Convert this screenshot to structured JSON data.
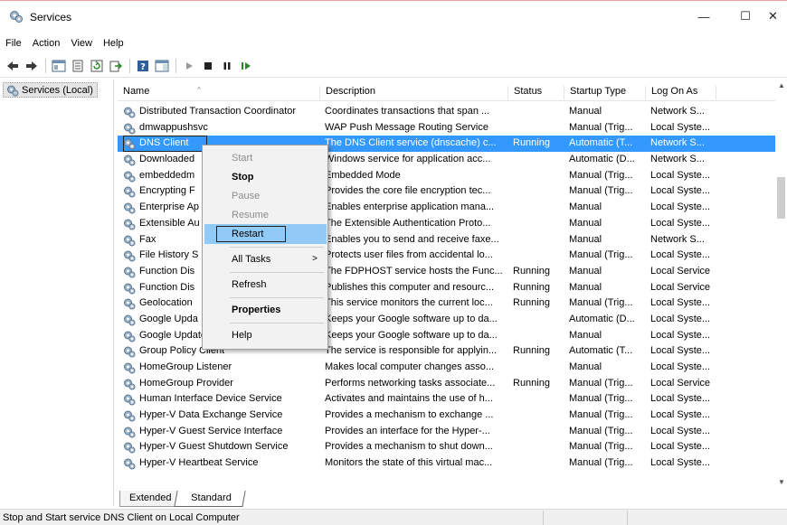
{
  "window": {
    "title": "Services",
    "min_glyph": "—",
    "max_glyph": "☐",
    "close_glyph": "✕"
  },
  "menubar": {
    "items": [
      "File",
      "Action",
      "View",
      "Help"
    ]
  },
  "tree": {
    "root_label": "Services (Local)"
  },
  "list": {
    "columns": [
      "Name",
      "Description",
      "Status",
      "Startup Type",
      "Log On As"
    ],
    "rows": [
      {
        "name": "Distributed Transaction Coordinator",
        "description": "Coordinates transactions that span ...",
        "status": "",
        "startup": "Manual",
        "logon": "Network S..."
      },
      {
        "name": "dmwappushsvc",
        "description": "WAP Push Message Routing Service",
        "status": "",
        "startup": "Manual (Trig...",
        "logon": "Local Syste..."
      },
      {
        "name": "DNS Client",
        "description": "The DNS Client service (dnscache) c...",
        "status": "Running",
        "startup": "Automatic (T...",
        "logon": "Network S..."
      },
      {
        "name": "Downloaded",
        "description": "Windows service for application acc...",
        "status": "",
        "startup": "Automatic (D...",
        "logon": "Network S..."
      },
      {
        "name": "embeddedm",
        "description": "Embedded Mode",
        "status": "",
        "startup": "Manual (Trig...",
        "logon": "Local Syste..."
      },
      {
        "name": "Encrypting F",
        "description": "Provides the core file encryption tec...",
        "status": "",
        "startup": "Manual (Trig...",
        "logon": "Local Syste..."
      },
      {
        "name": "Enterprise Ap",
        "description": "Enables enterprise application mana...",
        "status": "",
        "startup": "Manual",
        "logon": "Local Syste..."
      },
      {
        "name": "Extensible Au",
        "description": "The Extensible Authentication Proto...",
        "status": "",
        "startup": "Manual",
        "logon": "Local Syste..."
      },
      {
        "name": "Fax",
        "description": "Enables you to send and receive faxe...",
        "status": "",
        "startup": "Manual",
        "logon": "Network S..."
      },
      {
        "name": "File History S",
        "description": "Protects user files from accidental lo...",
        "status": "",
        "startup": "Manual (Trig...",
        "logon": "Local Syste..."
      },
      {
        "name": "Function Dis",
        "description": "The FDPHOST service hosts the Func...",
        "status": "Running",
        "startup": "Manual",
        "logon": "Local Service"
      },
      {
        "name": "Function Dis",
        "description": "Publishes this computer and resourc...",
        "status": "Running",
        "startup": "Manual",
        "logon": "Local Service"
      },
      {
        "name": "Geolocation",
        "description": "This service monitors the current loc...",
        "status": "Running",
        "startup": "Manual (Trig...",
        "logon": "Local Syste..."
      },
      {
        "name": "Google Upda",
        "description": "Keeps your Google software up to da...",
        "status": "",
        "startup": "Automatic (D...",
        "logon": "Local Syste..."
      },
      {
        "name": "Google Update Service (gupdatem)",
        "description": "Keeps your Google software up to da...",
        "status": "",
        "startup": "Manual",
        "logon": "Local Syste..."
      },
      {
        "name": "Group Policy Client",
        "description": "The service is responsible for applyin...",
        "status": "Running",
        "startup": "Automatic (T...",
        "logon": "Local Syste..."
      },
      {
        "name": "HomeGroup Listener",
        "description": "Makes local computer changes asso...",
        "status": "",
        "startup": "Manual",
        "logon": "Local Syste..."
      },
      {
        "name": "HomeGroup Provider",
        "description": "Performs networking tasks associate...",
        "status": "Running",
        "startup": "Manual (Trig...",
        "logon": "Local Service"
      },
      {
        "name": "Human Interface Device Service",
        "description": "Activates and maintains the use of h...",
        "status": "",
        "startup": "Manual (Trig...",
        "logon": "Local Syste..."
      },
      {
        "name": "Hyper-V Data Exchange Service",
        "description": "Provides a mechanism to exchange ...",
        "status": "",
        "startup": "Manual (Trig...",
        "logon": "Local Syste..."
      },
      {
        "name": "Hyper-V Guest Service Interface",
        "description": "Provides an interface for the Hyper-...",
        "status": "",
        "startup": "Manual (Trig...",
        "logon": "Local Syste..."
      },
      {
        "name": "Hyper-V Guest Shutdown Service",
        "description": "Provides a mechanism to shut down...",
        "status": "",
        "startup": "Manual (Trig...",
        "logon": "Local Syste..."
      },
      {
        "name": "Hyper-V Heartbeat Service",
        "description": "Monitors the state of this virtual mac...",
        "status": "",
        "startup": "Manual (Trig...",
        "logon": "Local Syste..."
      }
    ],
    "selected_index": 2
  },
  "context_menu": {
    "start": "Start",
    "stop": "Stop",
    "pause": "Pause",
    "resume": "Resume",
    "restart": "Restart",
    "all_tasks": "All Tasks",
    "refresh": "Refresh",
    "properties": "Properties",
    "help": "Help"
  },
  "tabs": {
    "extended": "Extended",
    "standard": "Standard"
  },
  "statusbar": {
    "text": "Stop and Start service DNS Client on Local Computer"
  },
  "colors": {
    "selection": "#3399ff",
    "menu_highlight": "#91c9f7"
  }
}
